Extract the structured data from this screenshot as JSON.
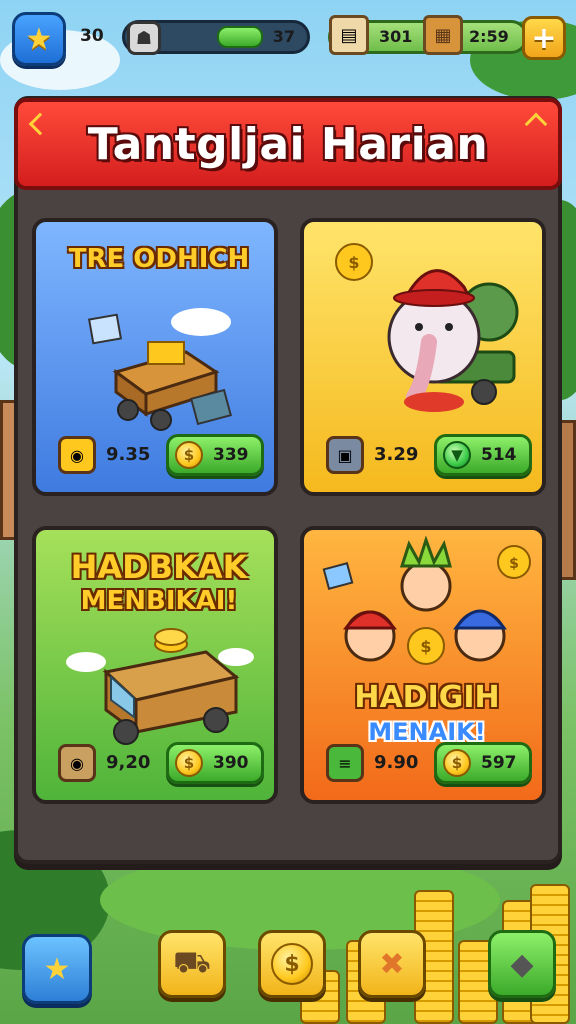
{
  "hud": {
    "level": "30",
    "xp_value": "37",
    "resource1_value": "301",
    "resource2_value": "2:59",
    "icons": {
      "star": "star-icon",
      "xp": "badge-icon",
      "res1": "scroll-icon",
      "res2": "crate-icon",
      "plus": "plus-icon"
    }
  },
  "banner": {
    "title": "Tantgljai Harian"
  },
  "cards": [
    {
      "title": "TRE ODHICH",
      "cost_value": "9.35",
      "buy_value": "339",
      "cost_icon": "pot-icon",
      "buy_icon": "coin-icon"
    },
    {
      "title": "",
      "cost_value": "3.29",
      "buy_value": "514",
      "cost_icon": "cube-icon",
      "buy_icon": "gem-icon"
    },
    {
      "title_line1": "HADBKAK",
      "title_line2": "MENBIKAI!",
      "cost_value": "9,20",
      "buy_value": "390",
      "cost_icon": "pot-icon",
      "buy_icon": "coin-icon"
    },
    {
      "title_line1": "HADIGIH",
      "title_line2": "MENAIK!",
      "cost_value": "9.90",
      "buy_value": "597",
      "cost_icon": "cash-icon",
      "buy_icon": "coin-icon"
    }
  ],
  "bottom_nav": [
    {
      "name": "home",
      "icon": "star-icon"
    },
    {
      "name": "shop",
      "icon": "cart-icon"
    },
    {
      "name": "coins",
      "icon": "coin-icon"
    },
    {
      "name": "tools",
      "icon": "crossed-tools-icon"
    },
    {
      "name": "settings",
      "icon": "rock-icon"
    }
  ],
  "colors": {
    "banner": "#e02a22",
    "board": "#4a4341",
    "buy_button": "#5cc83a",
    "gold": "#ffc81e"
  }
}
